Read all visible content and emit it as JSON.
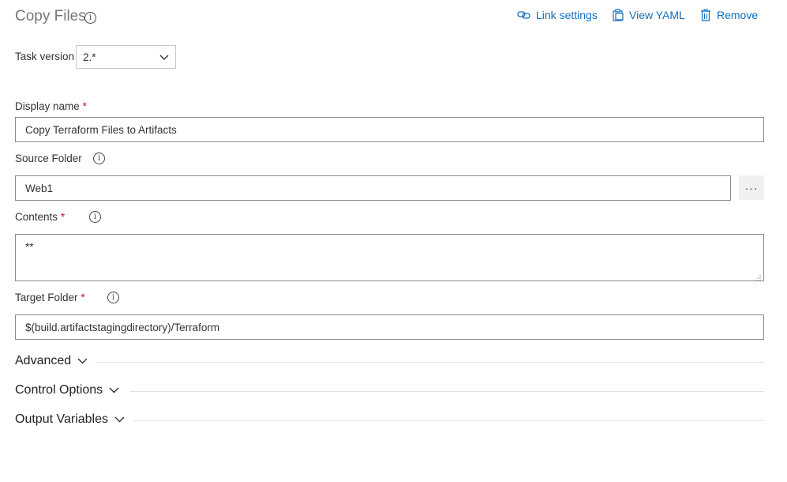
{
  "header": {
    "title": "Copy Files",
    "link_settings": "Link settings",
    "view_yaml": "View YAML",
    "remove": "Remove"
  },
  "task_version": {
    "label": "Task version",
    "value": "2.*"
  },
  "display_name": {
    "label": "Display name",
    "required": "*",
    "value": "Copy Terraform Files to Artifacts"
  },
  "source_folder": {
    "label": "Source Folder",
    "value": "Web1",
    "browse": "···"
  },
  "contents": {
    "label": "Contents",
    "required": "*",
    "value": "**"
  },
  "target_folder": {
    "label": "Target Folder",
    "required": "*",
    "value": "$(build.artifactstagingdirectory)/Terraform"
  },
  "sections": {
    "advanced": "Advanced",
    "control_options": "Control Options",
    "output_variables": "Output Variables"
  },
  "colors": {
    "accent": "#106ebe",
    "required": "#c50f1f"
  },
  "icons": {
    "info": "info-icon",
    "link": "link-icon",
    "yaml": "clipboard-icon",
    "remove": "trash-icon",
    "chevron": "chevron-down-icon"
  }
}
